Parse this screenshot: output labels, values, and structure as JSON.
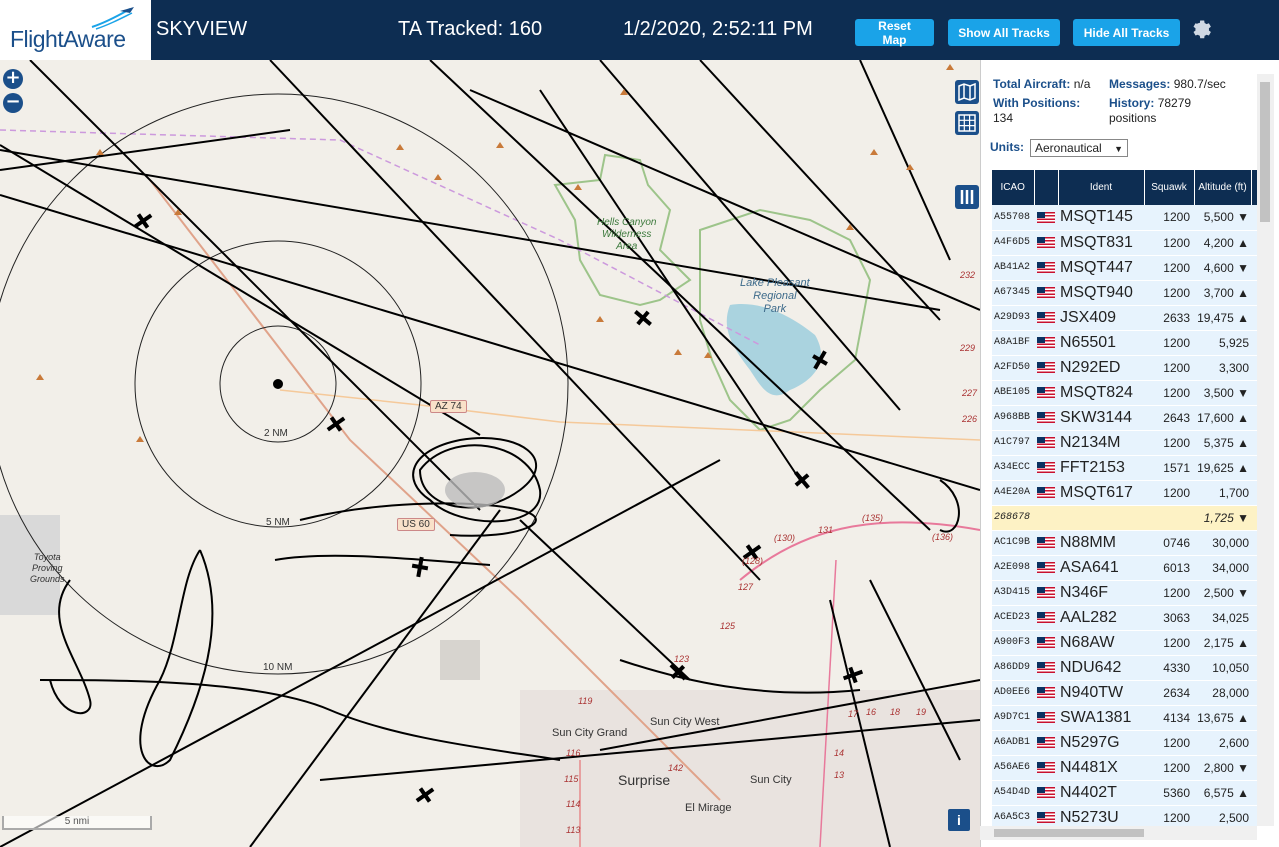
{
  "header": {
    "logo_text_flight": "Flight",
    "logo_text_aware": "Aware",
    "site_title": "SKYVIEW",
    "tracked_label": "TA Tracked: 160",
    "clock": "1/2/2020, 2:52:11 PM",
    "buttons": {
      "reset_map": "Reset Map",
      "show_all_tracks": "Show All Tracks",
      "hide_all_tracks": "Hide All Tracks"
    }
  },
  "map": {
    "zoom_in": "+",
    "zoom_out": "−",
    "scale_label": "5 nmi",
    "info": "i",
    "range_rings": [
      "2 NM",
      "5 NM",
      "10 NM"
    ],
    "place_labels": {
      "hells_canyon": "Hells Canyon\nWilderness\nArea",
      "lake_pleasant": "Lake Pleasant\nRegional\nPark",
      "toyota": "Toyota\nProving\nGrounds",
      "sun_city_grand": "Sun City Grand",
      "sun_city_west": "Sun City West",
      "surprise": "Surprise",
      "sun_city": "Sun City",
      "el_mirage": "El Mirage"
    },
    "road_shields": [
      "AZ 74",
      "US 60"
    ],
    "road_numbers": [
      "119",
      "116",
      "115",
      "114",
      "113",
      "142",
      "131",
      "(130)",
      "(135)",
      "(136)",
      "(128)",
      "127",
      "125",
      "123",
      "17",
      "16",
      "18",
      "19",
      "14",
      "13",
      "232",
      "229",
      "227",
      "226"
    ]
  },
  "sidebar": {
    "total_aircraft_label": "Total Aircraft:",
    "total_aircraft_value": "n/a",
    "messages_label": "Messages:",
    "messages_value": "980.7/sec",
    "with_positions_label": "With Positions:",
    "with_positions_value": "134",
    "history_label": "History:",
    "history_value": "78279",
    "history_unit": "positions",
    "units_label": "Units:",
    "units_value": "Aeronautical",
    "columns": {
      "icao": "ICAO",
      "ident": "Ident",
      "squawk": "Squawk",
      "altitude": "Altitude (ft)"
    },
    "rows": [
      {
        "icao": "A55708",
        "ident": "MSQT145",
        "squawk": "1200",
        "alt": "5,500 ▼"
      },
      {
        "icao": "A4F6D5",
        "ident": "MSQT831",
        "squawk": "1200",
        "alt": "4,200 ▲"
      },
      {
        "icao": "AB41A2",
        "ident": "MSQT447",
        "squawk": "1200",
        "alt": "4,600 ▼"
      },
      {
        "icao": "A67345",
        "ident": "MSQT940",
        "squawk": "1200",
        "alt": "3,700 ▲"
      },
      {
        "icao": "A29D93",
        "ident": "JSX409",
        "squawk": "2633",
        "alt": "19,475 ▲"
      },
      {
        "icao": "A8A1BF",
        "ident": "N65501",
        "squawk": "1200",
        "alt": "5,925"
      },
      {
        "icao": "A2FD50",
        "ident": "N292ED",
        "squawk": "1200",
        "alt": "3,300"
      },
      {
        "icao": "ABE105",
        "ident": "MSQT824",
        "squawk": "1200",
        "alt": "3,500 ▼"
      },
      {
        "icao": "A968BB",
        "ident": "SKW3144",
        "squawk": "2643",
        "alt": "17,600 ▲"
      },
      {
        "icao": "A1C797",
        "ident": "N2134M",
        "squawk": "1200",
        "alt": "5,375 ▲"
      },
      {
        "icao": "A34ECC",
        "ident": "FFT2153",
        "squawk": "1571",
        "alt": "19,625 ▲"
      },
      {
        "icao": "A4E20A",
        "ident": "MSQT617",
        "squawk": "1200",
        "alt": "1,700"
      },
      {
        "icao": "268678",
        "ident": "",
        "squawk": "",
        "alt": "1,725 ▼",
        "selected": true,
        "noflag": true
      },
      {
        "icao": "AC1C9B",
        "ident": "N88MM",
        "squawk": "0746",
        "alt": "30,000"
      },
      {
        "icao": "A2E098",
        "ident": "ASA641",
        "squawk": "6013",
        "alt": "34,000"
      },
      {
        "icao": "A3D415",
        "ident": "N346F",
        "squawk": "1200",
        "alt": "2,500 ▼"
      },
      {
        "icao": "ACED23",
        "ident": "AAL282",
        "squawk": "3063",
        "alt": "34,025"
      },
      {
        "icao": "A900F3",
        "ident": "N68AW",
        "squawk": "1200",
        "alt": "2,175 ▲"
      },
      {
        "icao": "A86DD9",
        "ident": "NDU642",
        "squawk": "4330",
        "alt": "10,050"
      },
      {
        "icao": "AD0EE6",
        "ident": "N940TW",
        "squawk": "2634",
        "alt": "28,000"
      },
      {
        "icao": "A9D7C1",
        "ident": "SWA1381",
        "squawk": "4134",
        "alt": "13,675 ▲"
      },
      {
        "icao": "A6ADB1",
        "ident": "N5297G",
        "squawk": "1200",
        "alt": "2,600"
      },
      {
        "icao": "A56AE6",
        "ident": "N4481X",
        "squawk": "1200",
        "alt": "2,800 ▼"
      },
      {
        "icao": "A54D4D",
        "ident": "N4402T",
        "squawk": "5360",
        "alt": "6,575 ▲"
      },
      {
        "icao": "A6A5C3",
        "ident": "N5273U",
        "squawk": "1200",
        "alt": "2,500"
      }
    ]
  },
  "colors": {
    "header_bg": "#0d2d52",
    "button_bg": "#1aa3e8",
    "map_bg": "#f2efe9",
    "row_bg": "#e7f3fd",
    "selected_row_bg": "#fdf2c5",
    "track": "#000000"
  },
  "icons": [
    "gear-icon",
    "zoom-in-icon",
    "zoom-out-icon",
    "map-layers-icon",
    "grid-icon",
    "columns-icon",
    "info-icon",
    "us-flag-icon",
    "aircraft-icon"
  ]
}
